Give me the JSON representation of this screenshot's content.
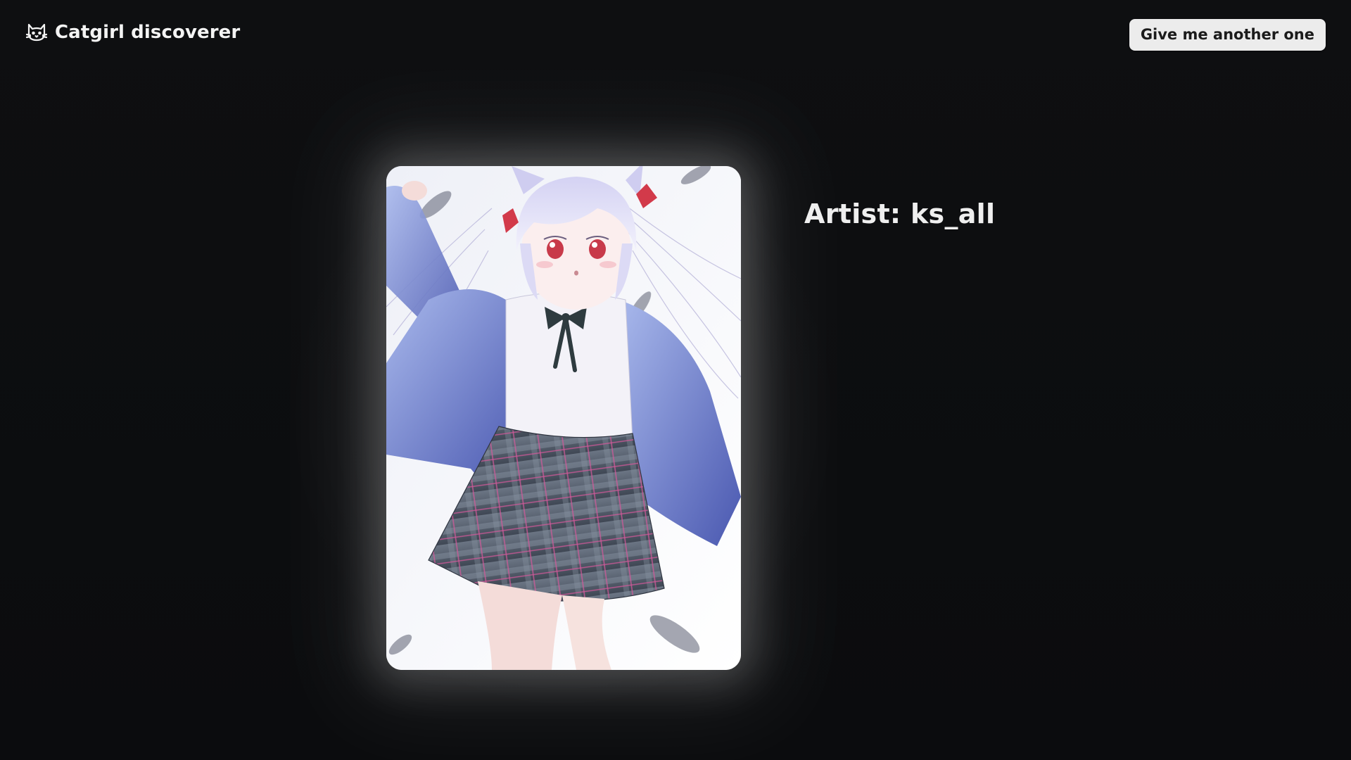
{
  "app": {
    "title": "Catgirl discoverer",
    "brand_icon": "cat-face-icon"
  },
  "header": {
    "next_button_label": "Give me another one"
  },
  "main": {
    "artist_label": "Artist: ks_all",
    "image_alt": "catgirl-illustration"
  },
  "colors": {
    "background": "#0c0d0f",
    "button_bg": "#ececec",
    "text": "#f2f2f2"
  }
}
